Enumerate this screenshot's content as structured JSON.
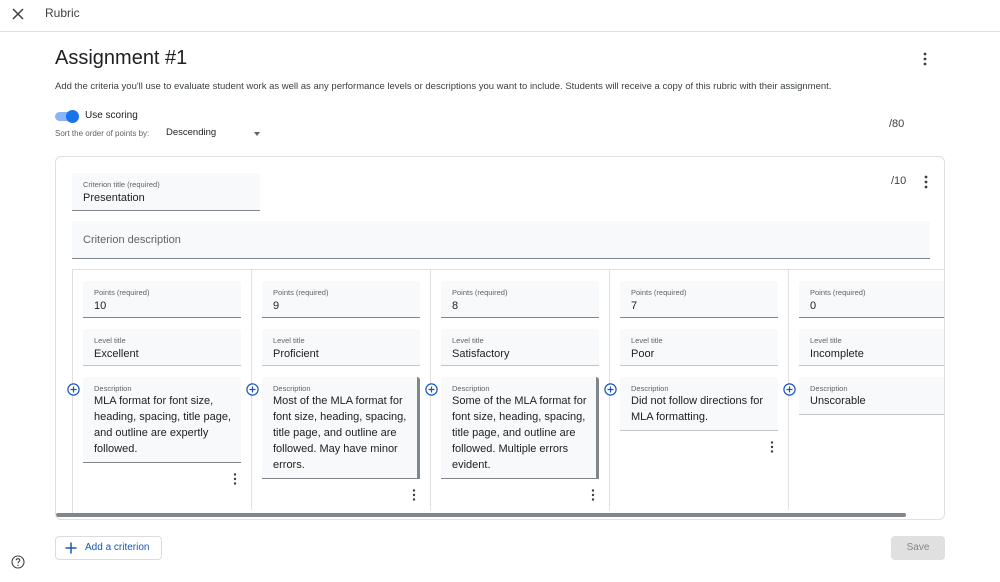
{
  "topbar": {
    "title": "Rubric",
    "close_icon": "close-icon"
  },
  "header": {
    "title": "Assignment #1",
    "intro": "Add the criteria you'll use to evaluate student work as well as any performance levels or descriptions you want to include. Students will receive a copy of this rubric with their assignment.",
    "use_scoring_label": "Use scoring",
    "use_scoring_on": true,
    "sort_label": "Sort the order of points by:",
    "sort_value": "Descending",
    "total_points": "/80"
  },
  "criterion": {
    "title_label": "Criterion title (required)",
    "title_value": "Presentation",
    "description_placeholder": "Criterion description",
    "points": "/10",
    "levels": [
      {
        "points_label": "Points (required)",
        "points": "10",
        "title_label": "Level title",
        "title": "Excellent",
        "desc_label": "Description",
        "description": "MLA format for font size, heading, spacing, title page, and outline are expertly followed."
      },
      {
        "points_label": "Points (required)",
        "points": "9",
        "title_label": "Level title",
        "title": "Proficient",
        "desc_label": "Description",
        "description": "Most of the MLA format for font size, heading, spacing, title page, and outline are followed. May have minor errors."
      },
      {
        "points_label": "Points (required)",
        "points": "8",
        "title_label": "Level title",
        "title": "Satisfactory",
        "desc_label": "Description",
        "description": "Some of the MLA format for font size, heading, spacing, title page, and outline are followed. Multiple errors evident."
      },
      {
        "points_label": "Points (required)",
        "points": "7",
        "title_label": "Level title",
        "title": "Poor",
        "desc_label": "Description",
        "description": "Did not follow directions for MLA formatting."
      },
      {
        "points_label": "Points (required)",
        "points": "0",
        "title_label": "Level title",
        "title": "Incomplete",
        "desc_label": "Description",
        "description": "Unscorable"
      }
    ]
  },
  "footer": {
    "add_criterion_label": "Add a criterion",
    "save_label": "Save"
  },
  "colors": {
    "accent": "#1a73e8",
    "accent_light": "#8ab4f8",
    "link": "#1a56b8",
    "field_bg": "#f8f9fa",
    "disabled_bg": "#e0e0e0"
  }
}
